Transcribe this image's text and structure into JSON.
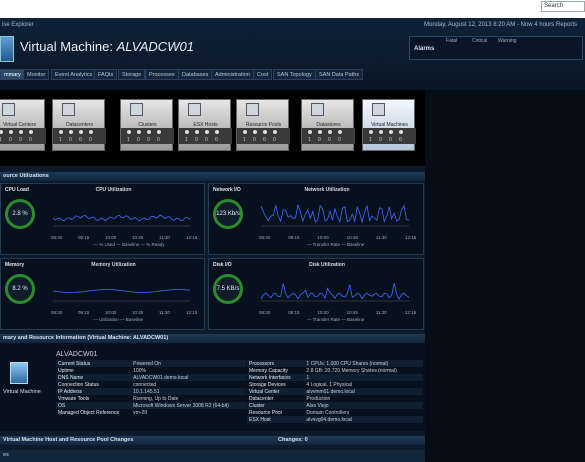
{
  "top": {
    "breadcrumb": "ise Explorer",
    "datetime": "Monday, August 12, 2013 8:20 AM - Now 4 hours",
    "reports": "Reports",
    "search_placeholder": "Search"
  },
  "title": {
    "prefix": "Virtual Machine:",
    "name": "ALVADCW01"
  },
  "alarms": {
    "headers": [
      "Fatal",
      "Critical",
      "Warning"
    ],
    "label": "Alarms"
  },
  "tabs": [
    "mmary",
    "Monitor",
    "Event Analytics",
    "FAQts",
    "Storage",
    "Processes",
    "Databases",
    "Administration",
    "Cost",
    "SAN Topology",
    "SAN Data Paths"
  ],
  "tiles": [
    {
      "label": "Virtual Centers"
    },
    {
      "label": "Datacenters"
    },
    {
      "label": "Clusters"
    },
    {
      "label": "ESX Hosts"
    },
    {
      "label": "Resource Pools"
    },
    {
      "label": "Datastores"
    },
    {
      "label": "Virtual Machines"
    }
  ],
  "tile_counts": [
    "1",
    "0",
    "0",
    "0",
    "1",
    "3"
  ],
  "sections": {
    "resource": "ource Utilizations",
    "info": "mary and Resource Information (Virtual Machine: ALVADCW01)",
    "changes": "Virtual Machine Host and Resource Pool Changes",
    "changes_right": "Changes: 0",
    "footer": "es"
  },
  "panels": [
    {
      "title": "CPU Load",
      "gauge": "2.8 %",
      "chart": "CPU Utilization",
      "legend": "— % Used  — Baseline  — % Ready",
      "times": [
        "08:30",
        "09:15",
        "10:00",
        "10:45",
        "11:30",
        "12:15"
      ]
    },
    {
      "title": "Network I/O",
      "gauge": "123 Kb/s",
      "chart": "Network Utilization",
      "legend": "— Transfer Rate  — Baseline",
      "times": [
        "08:30",
        "09:15",
        "10:00",
        "10:45",
        "11:30",
        "12:15"
      ]
    },
    {
      "title": "Memory",
      "gauge": "8.2 %",
      "chart": "Memory Utilization",
      "legend": "— Utilization  — Baseline",
      "times": [
        "08:30",
        "09:15",
        "10:00",
        "10:45",
        "11:30",
        "12:15"
      ]
    },
    {
      "title": "Disk I/O",
      "gauge": "7.5 KB/s",
      "chart": "Disk Utilization",
      "legend": "— Transfer Rate  — Baseline",
      "times": [
        "08:30",
        "09:15",
        "10:00",
        "10:45",
        "11:30",
        "12:15"
      ]
    }
  ],
  "vm": {
    "name": "ALVADCW01",
    "label": "Virtual Machine"
  },
  "info_left": [
    [
      "Current Status",
      "Powered On"
    ],
    [
      "Uptime",
      "100%"
    ],
    [
      "DNS Name",
      "ALVADCW01.demo.local"
    ],
    [
      "Connection Status",
      "connected"
    ],
    [
      "IP Address",
      "10.1.145.51"
    ],
    [
      "Vmware Tools",
      "Running, Up to Date"
    ],
    [
      "OS",
      "Microsoft Windows Server 2008 R2 (64-bit)"
    ],
    [
      "Managed Object Reference",
      "vm-29"
    ]
  ],
  "info_right": [
    [
      "Processors",
      "1 CPUs: 1,000 CPU Shares (normal)"
    ],
    [
      "Memory Capacity",
      "2.8 GB: 20,720 Memory Shares (normal)"
    ],
    [
      "Network Interfaces",
      "1"
    ],
    [
      "Storage Devices",
      "4 Logical, 1 Physical"
    ],
    [
      "Virtual Center",
      "alvvmm01.demo.local"
    ],
    [
      "Datacenter",
      "Production"
    ],
    [
      "Cluster",
      "Also Viejo"
    ],
    [
      "Resource Pool",
      "Domain Controllers"
    ],
    [
      "ESX Host",
      "alvsvg04.demo.local"
    ]
  ],
  "colors": {
    "gauge_green": "#2c8a2c",
    "line_blue": "#3b6bff",
    "accent": "#1e3a58"
  }
}
